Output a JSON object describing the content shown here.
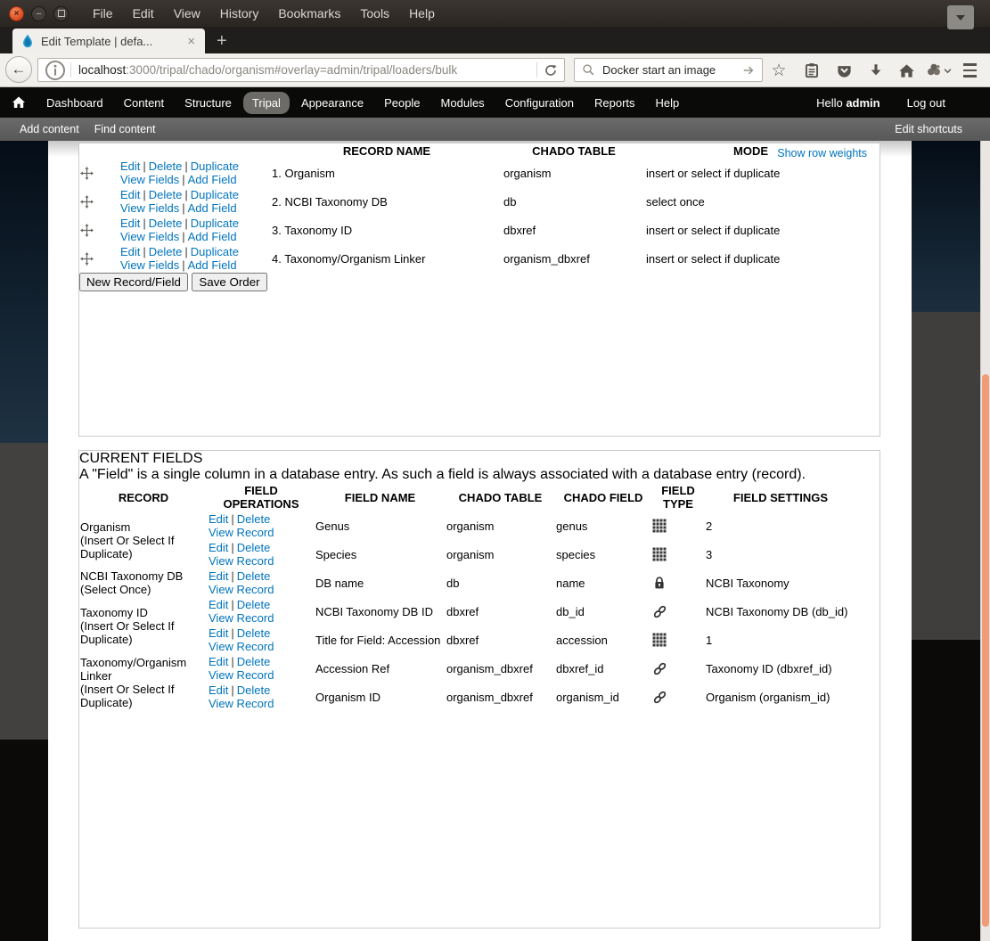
{
  "labels": {
    "sep": "|"
  },
  "window": {
    "menu": [
      "File",
      "Edit",
      "View",
      "History",
      "Bookmarks",
      "Tools",
      "Help"
    ],
    "close_glyph": "×",
    "minimize_glyph": "–"
  },
  "browser": {
    "tab": {
      "title": "Edit Template | defa...",
      "close_glyph": "×",
      "new_tab_glyph": "+"
    },
    "back_glyph": "←",
    "url": {
      "domain": "localhost",
      "rest": ":3000/tripal/chado/organism#overlay=admin/tripal/loaders/bulk"
    },
    "search": {
      "value": "Docker start an image"
    }
  },
  "admin_toolbar": {
    "items": [
      "Dashboard",
      "Content",
      "Structure",
      "Tripal",
      "Appearance",
      "People",
      "Modules",
      "Configuration",
      "Reports",
      "Help"
    ],
    "active_item": "Tripal",
    "hello": "Hello",
    "user": "admin",
    "logout": "Log out"
  },
  "shortcut_bar": {
    "items": [
      "Add content",
      "Find content"
    ],
    "edit_shortcuts": "Edit shortcuts"
  },
  "records_section": {
    "show_row_weights": "Show row weights",
    "headers": {
      "record_name": "RECORD NAME",
      "chado_table": "CHADO TABLE",
      "mode": "MODE"
    },
    "ops": {
      "edit": "Edit",
      "delete": "Delete",
      "duplicate": "Duplicate",
      "view_fields": "View Fields",
      "add_field": "Add Field"
    },
    "rows": [
      {
        "name": "1. Organism",
        "chado_table": "organism",
        "mode": "insert or select if duplicate"
      },
      {
        "name": "2. NCBI Taxonomy DB",
        "chado_table": "db",
        "mode": "select once"
      },
      {
        "name": "3. Taxonomy ID",
        "chado_table": "dbxref",
        "mode": "insert or select if duplicate"
      },
      {
        "name": "4. Taxonomy/Organism Linker",
        "chado_table": "organism_dbxref",
        "mode": "insert or select if duplicate"
      }
    ],
    "buttons": {
      "new_record": "New Record/Field",
      "save_order": "Save Order"
    }
  },
  "fields_section": {
    "legend": "CURRENT FIELDS",
    "description": "A \"Field\" is a single column in a database entry. As such a field is always associated with a database entry (record).",
    "headers": [
      "RECORD",
      "FIELD OPERATIONS",
      "FIELD NAME",
      "CHADO TABLE",
      "CHADO FIELD",
      "FIELD TYPE",
      "FIELD SETTINGS"
    ],
    "ops": {
      "edit": "Edit",
      "delete": "Delete",
      "view_record": "View Record"
    },
    "groups": [
      {
        "record": "Organism",
        "note": "(Insert Or Select If Duplicate)",
        "rows": [
          {
            "field_name": "Genus",
            "chado_table": "organism",
            "chado_field": "genus",
            "type_icon": "table-grid-icon",
            "settings": "2"
          },
          {
            "field_name": "Species",
            "chado_table": "organism",
            "chado_field": "species",
            "type_icon": "table-grid-icon",
            "settings": "3"
          }
        ]
      },
      {
        "record": "NCBI Taxonomy DB",
        "note": "(Select Once)",
        "rows": [
          {
            "field_name": "DB name",
            "chado_table": "db",
            "chado_field": "name",
            "type_icon": "lock-icon",
            "settings": "NCBI Taxonomy"
          }
        ]
      },
      {
        "record": "Taxonomy ID",
        "note": "(Insert Or Select If Duplicate)",
        "rows": [
          {
            "field_name": "NCBI Taxonomy DB ID",
            "chado_table": "dbxref",
            "chado_field": "db_id",
            "type_icon": "link-icon",
            "settings": "NCBI Taxonomy DB (db_id)"
          },
          {
            "field_name": "Title for Field: Accession",
            "chado_table": "dbxref",
            "chado_field": "accession",
            "type_icon": "table-grid-icon",
            "settings": "1"
          }
        ]
      },
      {
        "record": "Taxonomy/Organism Linker",
        "note": "(Insert Or Select If Duplicate)",
        "rows": [
          {
            "field_name": "Accession Ref",
            "chado_table": "organism_dbxref",
            "chado_field": "dbxref_id",
            "type_icon": "link-icon",
            "settings": "Taxonomy ID (dbxref_id)"
          },
          {
            "field_name": "Organism ID",
            "chado_table": "organism_dbxref",
            "chado_field": "organism_id",
            "type_icon": "link-icon",
            "settings": "Organism (organism_id)"
          }
        ]
      }
    ]
  },
  "colors": {
    "link": "#0074bd",
    "scrollbar_thumb": "#ef9c77",
    "active_nav_pill": "#6d6b67"
  }
}
